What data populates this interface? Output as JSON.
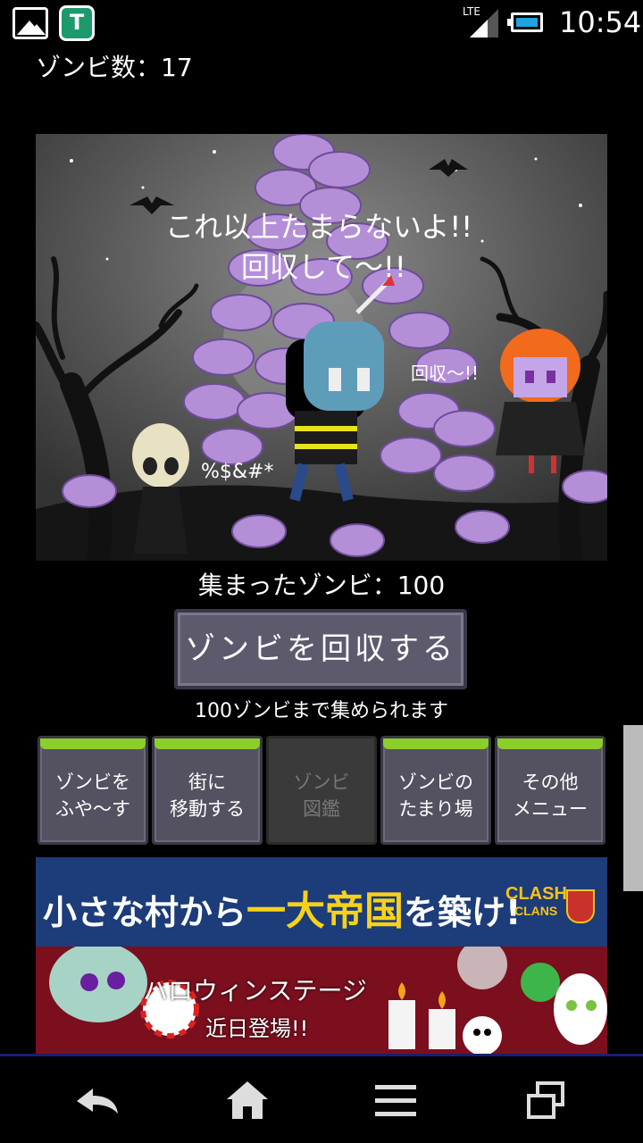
{
  "status_bar": {
    "network": "LTE",
    "time": "10:54",
    "icons": [
      "gallery-icon",
      "t-app-icon",
      "signal-icon",
      "battery-icon"
    ]
  },
  "game": {
    "zombie_count_label": "ゾンビ数：17",
    "scene": {
      "speech_main_line1": "これ以上たまらないよ!!",
      "speech_main_line2": "回収して〜!!",
      "speech_right": "回収〜!!",
      "speech_left": "%$&#*"
    },
    "collected_label": "集まったゾンビ：100",
    "collect_button": "ゾンビを回収する",
    "collect_note": "100ゾンビまで集められます",
    "menu": [
      {
        "line1": "ゾンビを",
        "line2": "ふや〜す",
        "enabled": true
      },
      {
        "line1": "街に",
        "line2": "移動する",
        "enabled": true
      },
      {
        "line1": "ゾンビ",
        "line2": "図鑑",
        "enabled": false
      },
      {
        "line1": "ゾンビの",
        "line2": "たまり場",
        "enabled": true
      },
      {
        "line1": "その他",
        "line2": "メニュー",
        "enabled": true
      }
    ]
  },
  "ad": {
    "headline_a": "小さな村から",
    "headline_b": "一大帝国",
    "headline_c": "を築け!",
    "logo_line1": "CLASH",
    "logo_line2": "CLANS",
    "halloween": "ハロウィンステージ",
    "coming_soon": "近日登場!!"
  },
  "nav": {
    "icons": [
      "back-icon",
      "home-icon",
      "menu-icon",
      "recent-apps-icon"
    ]
  },
  "colors": {
    "accent_slime": "#8bcf2a",
    "zombie_purple": "#b48fd8",
    "ad_blue": "#1c3c7a",
    "ad_red": "#7b0f1e"
  }
}
